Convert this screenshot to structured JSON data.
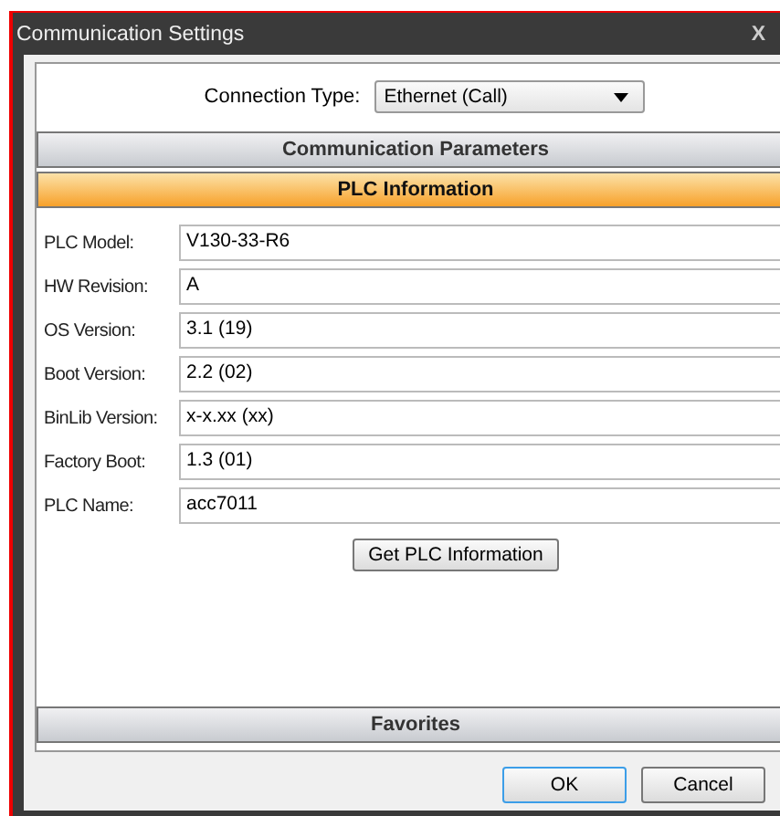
{
  "window": {
    "title": "Communication Settings",
    "close": "X"
  },
  "connection": {
    "label": "Connection Type:",
    "value": "Ethernet (Call)"
  },
  "sections": [
    {
      "title": "Communication Parameters",
      "selected": false
    },
    {
      "title": "PLC Information",
      "selected": true
    },
    {
      "title": "Favorites",
      "selected": false
    }
  ],
  "fields": [
    {
      "label": "PLC Model:",
      "value": "V130-33-R6"
    },
    {
      "label": "HW Revision:",
      "value": "A"
    },
    {
      "label": "OS Version:",
      "value": "3.1 (19)"
    },
    {
      "label": "Boot Version:",
      "value": "2.2 (02)"
    },
    {
      "label": "BinLib Version:",
      "value": "x-x.xx (xx)"
    },
    {
      "label": "Factory Boot:",
      "value": "1.3 (01)"
    },
    {
      "label": "PLC Name:",
      "value": "acc7011"
    }
  ],
  "get_button": "Get PLC Information",
  "buttons": [
    {
      "label": "OK",
      "default": true
    },
    {
      "label": "Cancel",
      "default": false
    }
  ]
}
